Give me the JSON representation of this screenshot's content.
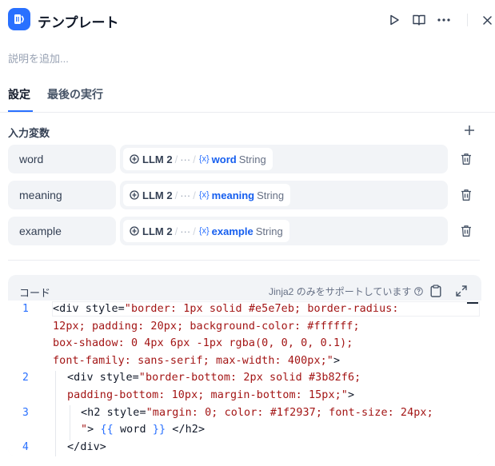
{
  "header": {
    "title": "テンプレート",
    "icons": {
      "app": "template-node-icon",
      "run": "play-icon",
      "docs": "book-icon",
      "more": "more-icon",
      "close": "close-icon"
    }
  },
  "description_placeholder": "説明を追加...",
  "tabs": [
    {
      "label": "設定",
      "active": true
    },
    {
      "label": "最後の実行",
      "active": false
    }
  ],
  "variables": {
    "label": "入力変数",
    "items": [
      {
        "name": "word",
        "node": "LLM 2",
        "path_ellipsis": "···",
        "var_prefix": "{x}",
        "var": "word",
        "type": "String"
      },
      {
        "name": "meaning",
        "node": "LLM 2",
        "path_ellipsis": "···",
        "var_prefix": "{x}",
        "var": "meaning",
        "type": "String"
      },
      {
        "name": "example",
        "node": "LLM 2",
        "path_ellipsis": "···",
        "var_prefix": "{x}",
        "var": "example",
        "type": "String"
      }
    ]
  },
  "code": {
    "title": "コード",
    "hint": "Jinja2 のみをサポートしています",
    "line_numbers": [
      "1",
      "2",
      "3",
      "4"
    ],
    "lines": [
      {
        "pre": "<div style=",
        "str": "\"border: 1px solid #e5e7eb; border-radius:"
      },
      {
        "str": "12px; padding: 20px; background-color: #ffffff;"
      },
      {
        "str": "box-shadow: 0 4px 6px -1px rgba(0, 0, 0, 0.1);"
      },
      {
        "str": "font-family: sans-serif; max-width: 400px;\"",
        "post": ">"
      },
      {
        "pre": "<div style=",
        "str": "\"border-bottom: 2px solid #3b82f6;"
      },
      {
        "str": "padding-bottom: 10px; margin-bottom: 15px;\"",
        "post": ">"
      },
      {
        "pre": "<h2 style=",
        "str": "\"margin: 0; color: #1f2937; font-size: 24px;"
      },
      {
        "str": "\"",
        "post": "> ",
        "tpl1": "{{",
        "mid": " word ",
        "tpl2": "}}",
        "tail": " </h2>"
      },
      {
        "pre": "</div>"
      }
    ]
  },
  "colors": {
    "accent": "#2970ff",
    "string": "#a31515"
  }
}
